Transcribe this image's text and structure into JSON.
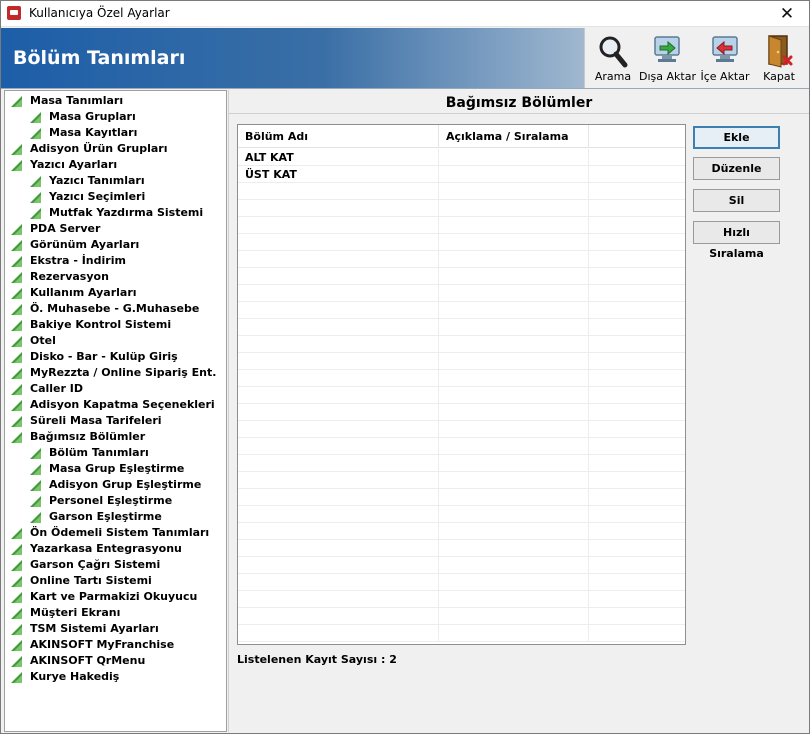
{
  "window": {
    "title": "Kullanıcıya Özel Ayarlar",
    "close_glyph": "✕"
  },
  "header": {
    "title": "Bölüm Tanımları"
  },
  "toolbar": {
    "items": [
      {
        "label": "Arama",
        "icon": "magnifier-icon"
      },
      {
        "label": "Dışa Aktar",
        "icon": "export-icon"
      },
      {
        "label": "İçe Aktar",
        "icon": "import-icon"
      },
      {
        "label": "Kapat",
        "icon": "exit-door-icon"
      }
    ]
  },
  "tree": {
    "items": [
      {
        "label": "Masa Tanımları",
        "level": 0
      },
      {
        "label": "Masa Grupları",
        "level": 1
      },
      {
        "label": "Masa Kayıtları",
        "level": 1
      },
      {
        "label": "Adisyon Ürün Grupları",
        "level": 0
      },
      {
        "label": "Yazıcı Ayarları",
        "level": 0
      },
      {
        "label": "Yazıcı Tanımları",
        "level": 1
      },
      {
        "label": "Yazıcı Seçimleri",
        "level": 1
      },
      {
        "label": "Mutfak Yazdırma Sistemi",
        "level": 1
      },
      {
        "label": "PDA Server",
        "level": 0
      },
      {
        "label": "Görünüm Ayarları",
        "level": 0
      },
      {
        "label": "Ekstra - İndirim",
        "level": 0
      },
      {
        "label": "Rezervasyon",
        "level": 0
      },
      {
        "label": "Kullanım Ayarları",
        "level": 0
      },
      {
        "label": "Ö. Muhasebe - G.Muhasebe",
        "level": 0
      },
      {
        "label": "Bakiye Kontrol Sistemi",
        "level": 0
      },
      {
        "label": "Otel",
        "level": 0
      },
      {
        "label": "Disko - Bar - Kulüp Giriş",
        "level": 0
      },
      {
        "label": "MyRezzta / Online Sipariş Ent.",
        "level": 0
      },
      {
        "label": "Caller ID",
        "level": 0
      },
      {
        "label": "Adisyon Kapatma Seçenekleri",
        "level": 0
      },
      {
        "label": "Süreli Masa Tarifeleri",
        "level": 0
      },
      {
        "label": "Bağımsız Bölümler",
        "level": 0
      },
      {
        "label": "Bölüm Tanımları",
        "level": 1
      },
      {
        "label": "Masa Grup Eşleştirme",
        "level": 1
      },
      {
        "label": "Adisyon Grup Eşleştirme",
        "level": 1
      },
      {
        "label": "Personel Eşleştirme",
        "level": 1
      },
      {
        "label": "Garson Eşleştirme",
        "level": 1
      },
      {
        "label": "Ön Ödemeli Sistem Tanımları",
        "level": 0
      },
      {
        "label": "Yazarkasa Entegrasyonu",
        "level": 0
      },
      {
        "label": "Garson Çağrı Sistemi",
        "level": 0
      },
      {
        "label": "Online Tartı Sistemi",
        "level": 0
      },
      {
        "label": "Kart ve Parmakizi Okuyucu",
        "level": 0
      },
      {
        "label": "Müşteri Ekranı",
        "level": 0
      },
      {
        "label": "TSM Sistemi Ayarları",
        "level": 0
      },
      {
        "label": "AKINSOFT MyFranchise",
        "level": 0
      },
      {
        "label": "AKINSOFT QrMenu",
        "level": 0
      },
      {
        "label": "Kurye Hakediş",
        "level": 0
      }
    ]
  },
  "content": {
    "title": "Bağımsız Bölümler",
    "columns": [
      "Bölüm Adı",
      "Açıklama / Sıralama",
      ""
    ],
    "rows": [
      [
        "ALT KAT",
        "",
        ""
      ],
      [
        "ÜST KAT",
        "",
        ""
      ]
    ],
    "buttons": {
      "add": "Ekle",
      "edit": "Düzenle",
      "delete": "Sil",
      "quick_sort": "Hızlı Sıralama"
    },
    "record_count_text": "Listelenen Kayıt Sayısı : 2"
  },
  "colors": {
    "header_start": "#1d5ea8",
    "tree_icon_green": "#3f9a3a",
    "primary_button_border": "#3c7fb1"
  }
}
